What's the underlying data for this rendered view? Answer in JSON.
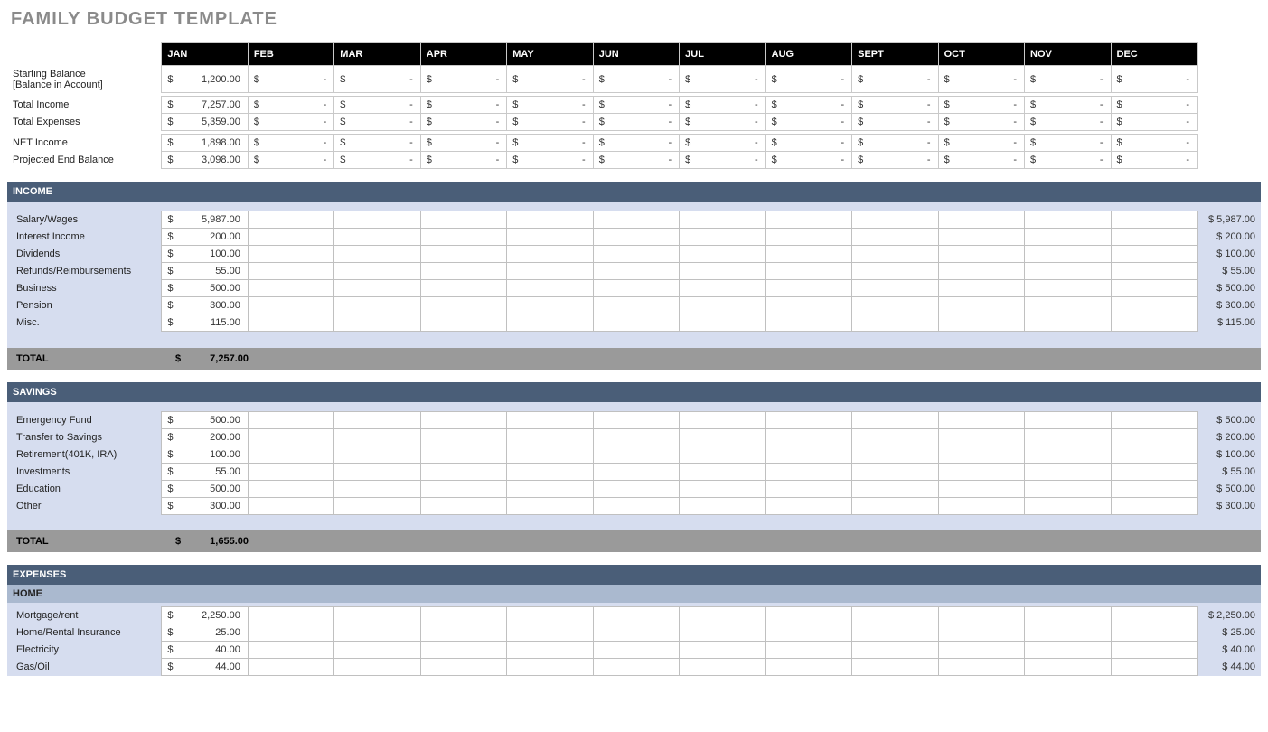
{
  "title": "FAMILY BUDGET TEMPLATE",
  "months": [
    "JAN",
    "FEB",
    "MAR",
    "APR",
    "MAY",
    "JUN",
    "JUL",
    "AUG",
    "SEPT",
    "OCT",
    "NOV",
    "DEC"
  ],
  "summary": {
    "rows": [
      {
        "label": "Starting Balance",
        "sublabel": "[Balance in Account]",
        "jan": "1,200.00"
      },
      {
        "label": "Total Income",
        "jan": "7,257.00"
      },
      {
        "label": "Total Expenses",
        "jan": "5,359.00"
      },
      {
        "label": "NET Income",
        "jan": "1,898.00"
      },
      {
        "label": "Projected End Balance",
        "jan": "3,098.00"
      }
    ]
  },
  "income": {
    "title": "INCOME",
    "rows": [
      {
        "label": "Salary/Wages",
        "jan": "5,987.00",
        "total": "$ 5,987.00"
      },
      {
        "label": "Interest Income",
        "jan": "200.00",
        "total": "$   200.00"
      },
      {
        "label": "Dividends",
        "jan": "100.00",
        "total": "$   100.00"
      },
      {
        "label": "Refunds/Reimbursements",
        "jan": "55.00",
        "total": "$    55.00"
      },
      {
        "label": "Business",
        "jan": "500.00",
        "total": "$   500.00"
      },
      {
        "label": "Pension",
        "jan": "300.00",
        "total": "$   300.00"
      },
      {
        "label": "Misc.",
        "jan": "115.00",
        "total": "$   115.00"
      }
    ],
    "total_label": "TOTAL",
    "total": "7,257.00"
  },
  "savings": {
    "title": "SAVINGS",
    "rows": [
      {
        "label": "Emergency Fund",
        "jan": "500.00",
        "total": "$   500.00"
      },
      {
        "label": "Transfer to Savings",
        "jan": "200.00",
        "total": "$   200.00"
      },
      {
        "label": "Retirement(401K, IRA)",
        "jan": "100.00",
        "total": "$   100.00"
      },
      {
        "label": "Investments",
        "jan": "55.00",
        "total": "$    55.00"
      },
      {
        "label": "Education",
        "jan": "500.00",
        "total": "$   500.00"
      },
      {
        "label": "Other",
        "jan": "300.00",
        "total": "$   300.00"
      }
    ],
    "total_label": "TOTAL",
    "total": "1,655.00"
  },
  "expenses": {
    "title": "EXPENSES",
    "subheader": "HOME",
    "rows": [
      {
        "label": "Mortgage/rent",
        "jan": "2,250.00",
        "total": "$ 2,250.00"
      },
      {
        "label": "Home/Rental Insurance",
        "jan": "25.00",
        "total": "$    25.00"
      },
      {
        "label": "Electricity",
        "jan": "40.00",
        "total": "$    40.00"
      },
      {
        "label": "Gas/Oil",
        "jan": "44.00",
        "total": "$    44.00"
      }
    ]
  }
}
